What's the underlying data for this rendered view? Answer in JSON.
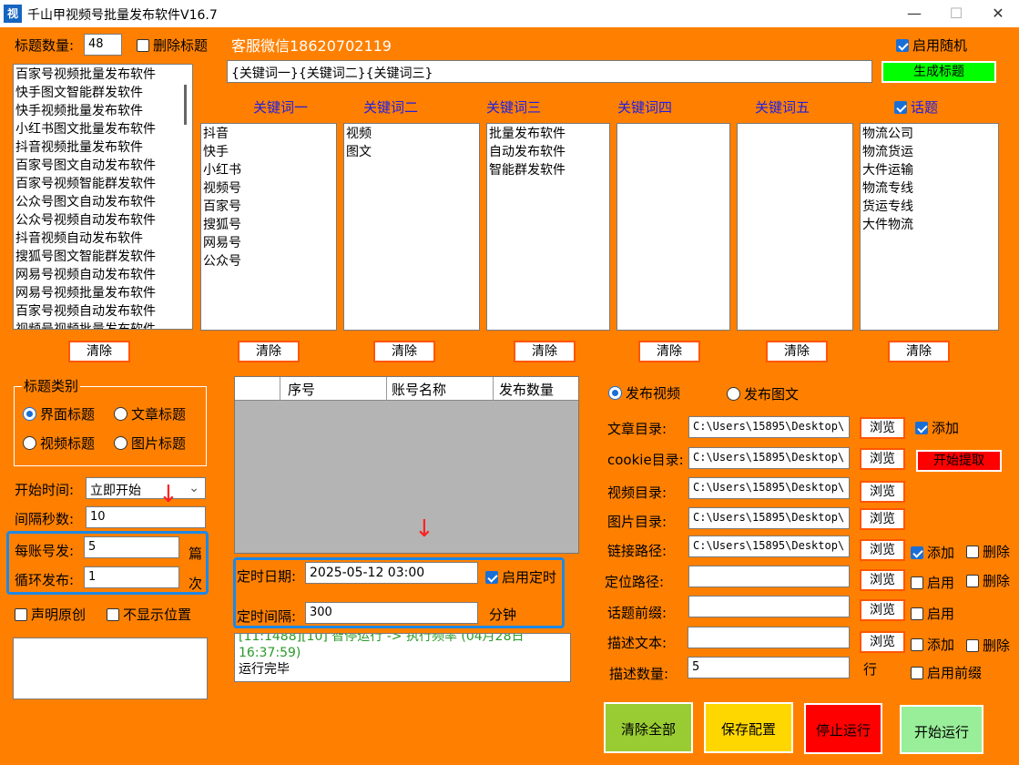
{
  "window": {
    "title": "千山甲视频号批量发布软件V16.7",
    "icon_glyph": "视",
    "minimize": "—",
    "maximize": "☐",
    "close": "✕"
  },
  "top": {
    "title_count_label": "标题数量:",
    "title_count_value": "48",
    "delete_title_label": "删除标题",
    "service_text": "客服微信18620702119",
    "random_label": "启用随机",
    "template_value": "{关键词一}{关键词二}{关键词三}",
    "generate_label": "生成标题"
  },
  "title_list": [
    "百家号视频批量发布软件",
    "快手图文智能群发软件",
    "快手视频批量发布软件",
    "小红书图文批量发布软件",
    "抖音视频批量发布软件",
    "百家号图文自动发布软件",
    "百家号视频智能群发软件",
    "公众号图文自动发布软件",
    "公众号视频自动发布软件",
    "抖音视频自动发布软件",
    "搜狐号图文智能群发软件",
    "网易号视频自动发布软件",
    "网易号视频批量发布软件",
    "百家号视频自动发布软件",
    "视频号视频批量发布软件"
  ],
  "keywords": {
    "col1": {
      "header": "关键词一",
      "items": [
        "抖音",
        "快手",
        "小红书",
        "视频号",
        "百家号",
        "搜狐号",
        "网易号",
        "公众号"
      ]
    },
    "col2": {
      "header": "关键词二",
      "items": [
        "视频",
        "图文"
      ]
    },
    "col3": {
      "header": "关键词三",
      "items": [
        "批量发布软件",
        "自动发布软件",
        "智能群发软件"
      ]
    },
    "col4": {
      "header": "关键词四",
      "items": []
    },
    "col5": {
      "header": "关键词五",
      "items": []
    },
    "col6": {
      "header": "话题",
      "items": [
        "物流公司",
        "物流货运",
        "大件运输",
        "物流专线",
        "货运专线",
        "大件物流"
      ]
    }
  },
  "clear_label": "清除",
  "title_type": {
    "legend": "标题类别",
    "opt1": "界面标题",
    "opt2": "文章标题",
    "opt3": "视频标题",
    "opt4": "图片标题"
  },
  "settings": {
    "start_label": "开始时间:",
    "start_value": "立即开始",
    "interval_label": "间隔秒数:",
    "interval_value": "10",
    "per_account_label": "每账号发:",
    "per_account_value": "5",
    "per_account_unit": "篇",
    "loop_label": "循环发布:",
    "loop_value": "1",
    "loop_unit": "次",
    "original_label": "声明原创",
    "hide_location_label": "不显示位置"
  },
  "grid": {
    "col_index": "序号",
    "col_account": "账号名称",
    "col_count": "发布数量"
  },
  "schedule": {
    "date_label": "定时日期:",
    "date_value": "2025-05-12 03:00",
    "enable_label": "启用定时",
    "interval_label": "定时间隔:",
    "interval_value": "300",
    "interval_unit": "分钟"
  },
  "log": {
    "line1": "[11:1488][10] 智停运行 -> 执行频率 (04月28日",
    "line2": "16:37:59)",
    "line3": "运行完毕"
  },
  "publish": {
    "video_label": "发布视频",
    "image_label": "发布图文",
    "article_dir_label": "文章目录:",
    "article_dir_value": "C:\\Users\\15895\\Desktop\\",
    "cookie_dir_label": "cookie目录:",
    "cookie_dir_value": "C:\\Users\\15895\\Desktop\\",
    "video_dir_label": "视频目录:",
    "video_dir_value": "C:\\Users\\15895\\Desktop\\",
    "image_dir_label": "图片目录:",
    "image_dir_value": "C:\\Users\\15895\\Desktop\\",
    "link_path_label": "链接路径:",
    "link_path_value": "C:\\Users\\15895\\Desktop\\",
    "locate_path_label": "定位路径:",
    "topic_prefix_label": "话题前缀:",
    "desc_text_label": "描述文本:",
    "desc_count_label": "描述数量:",
    "desc_count_value": "5",
    "desc_count_unit": "行",
    "browse": "浏览",
    "add": "添加",
    "delete": "删除",
    "enable": "启用",
    "enable_prefix": "启用前缀",
    "extract_label": "开始提取"
  },
  "actions": {
    "clear_all": "清除全部",
    "save": "保存配置",
    "stop": "停止运行",
    "start": "开始运行"
  },
  "colors": {
    "background": "#ff8000",
    "generate": "#00ff00",
    "extract": "#ff0000",
    "clear_all": "#99cc33",
    "save": "#ffd700",
    "stop": "#ff0000",
    "start": "#99ee99"
  }
}
